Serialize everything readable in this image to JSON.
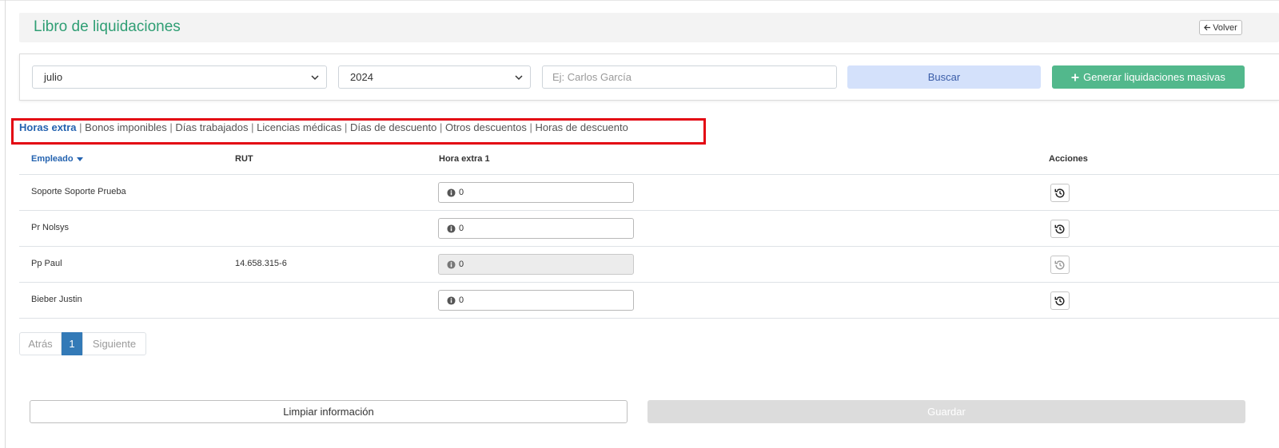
{
  "header": {
    "title": "Libro de liquidaciones",
    "back_label": "Volver"
  },
  "filters": {
    "month_value": "julio",
    "year_value": "2024",
    "search_placeholder": "Ej: Carlos García",
    "search_value": "",
    "search_button": "Buscar",
    "mass_button": "Generar liquidaciones masivas"
  },
  "tabs": [
    {
      "label": "Horas extra",
      "active": true
    },
    {
      "label": "Bonos imponibles",
      "active": false
    },
    {
      "label": "Días trabajados",
      "active": false
    },
    {
      "label": "Licencias médicas",
      "active": false
    },
    {
      "label": "Días de descuento",
      "active": false
    },
    {
      "label": "Otros descuentos",
      "active": false
    },
    {
      "label": "Horas de descuento",
      "active": false
    }
  ],
  "tab_separator": "|",
  "table": {
    "columns": {
      "employee": "Empleado",
      "rut": "RUT",
      "overtime": "Hora extra 1",
      "actions": "Acciones"
    },
    "rows": [
      {
        "employee": "Soporte Soporte Prueba",
        "rut": "",
        "overtime": "0",
        "disabled": false
      },
      {
        "employee": "Pr Nolsys",
        "rut": "",
        "overtime": "0",
        "disabled": false
      },
      {
        "employee": "Pp Paul",
        "rut": "14.658.315-6",
        "overtime": "0",
        "disabled": true
      },
      {
        "employee": "Bieber Justin",
        "rut": "",
        "overtime": "0",
        "disabled": false
      }
    ]
  },
  "pagination": {
    "prev": "Atrás",
    "current": "1",
    "next": "Siguiente"
  },
  "footer": {
    "clear_button": "Limpiar información",
    "save_button": "Guardar"
  },
  "colors": {
    "accent_green": "#2f9e74",
    "primary_blue": "#2463b0",
    "highlight_red": "#e30613"
  }
}
